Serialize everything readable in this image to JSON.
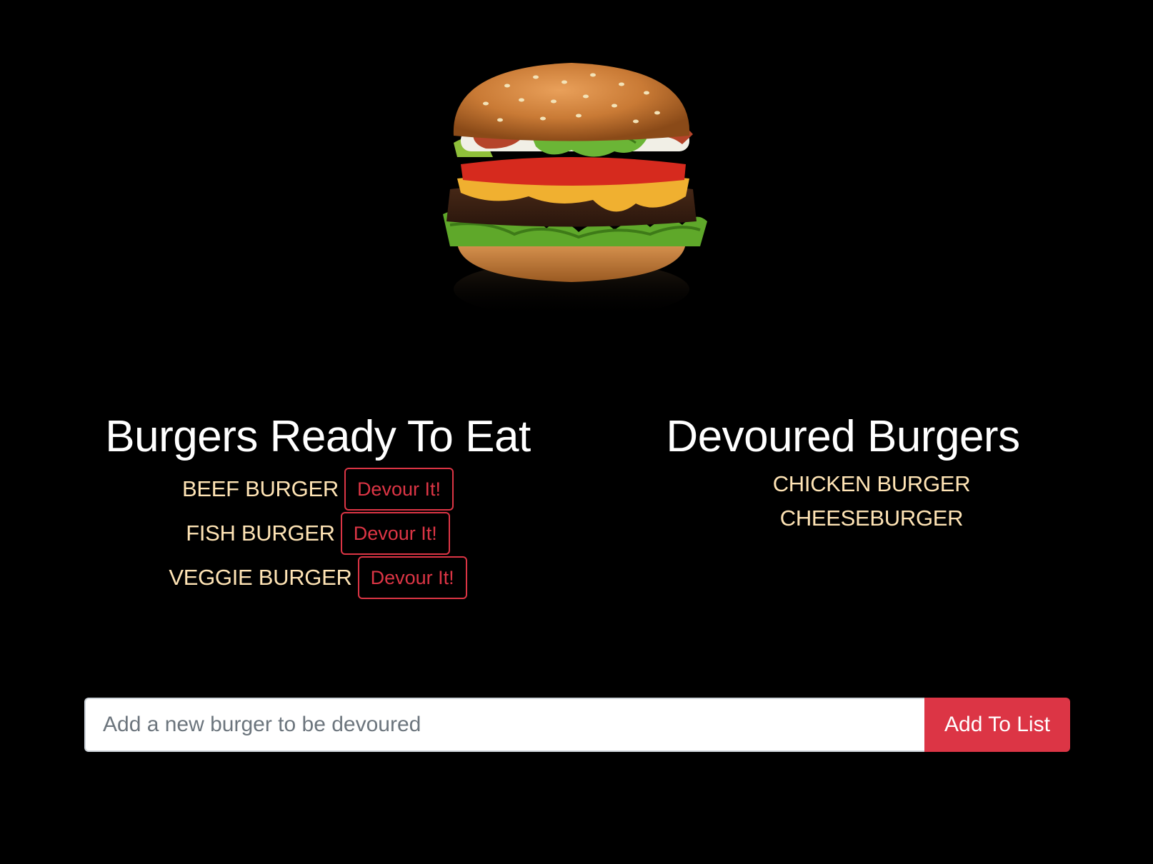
{
  "hero": {
    "image": "burger-photo"
  },
  "ready": {
    "title": "Burgers Ready To Eat",
    "items": [
      {
        "name": "BEEF BURGER",
        "button_label": "Devour It!"
      },
      {
        "name": "FISH BURGER",
        "button_label": "Devour It!"
      },
      {
        "name": "VEGGIE BURGER",
        "button_label": "Devour It!"
      }
    ]
  },
  "devoured": {
    "title": "Devoured Burgers",
    "items": [
      "CHICKEN BURGER",
      "CHEESEBURGER"
    ]
  },
  "form": {
    "placeholder": "Add a new burger to be devoured",
    "value": "",
    "button_label": "Add To List"
  },
  "colors": {
    "background": "#000000",
    "heading": "#ffffff",
    "item_text": "#ffe4b5",
    "accent": "#dc3545"
  }
}
